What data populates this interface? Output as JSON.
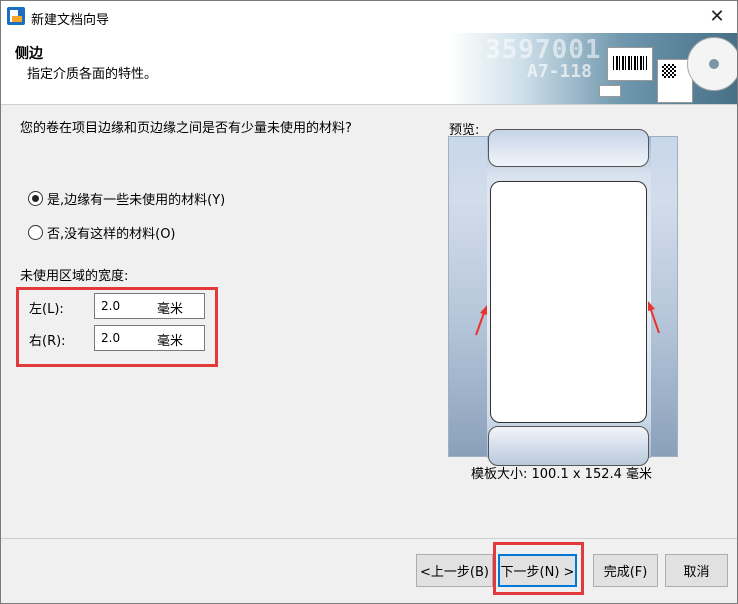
{
  "window": {
    "title": "新建文档向导"
  },
  "header": {
    "title": "侧边",
    "subtitle": "指定介质各面的特性。",
    "banner_number": "3597001",
    "banner_code": "A7-118"
  },
  "question": "您的卷在项目边缘和页边缘之间是否有少量未使用的材料?",
  "options": [
    {
      "label": "是,边缘有一些未使用的材料(Y)",
      "checked": true
    },
    {
      "label": "否,没有这样的材料(O)",
      "checked": false
    }
  ],
  "width_section": {
    "label": "未使用区域的宽度:",
    "left": {
      "label": "左(L):",
      "value": "2.0",
      "unit": "毫米"
    },
    "right": {
      "label": "右(R):",
      "value": "2.0",
      "unit": "毫米"
    }
  },
  "preview": {
    "label": "预览:",
    "size_text": "模板大小: 100.1 x 152.4 毫米"
  },
  "buttons": {
    "back": "<上一步(B)",
    "next": "下一步(N) >",
    "finish": "完成(F)",
    "cancel": "取消"
  },
  "colors": {
    "highlight": "#e23a3a",
    "focus_border": "#0078d7",
    "arrow": "#e8352c"
  }
}
